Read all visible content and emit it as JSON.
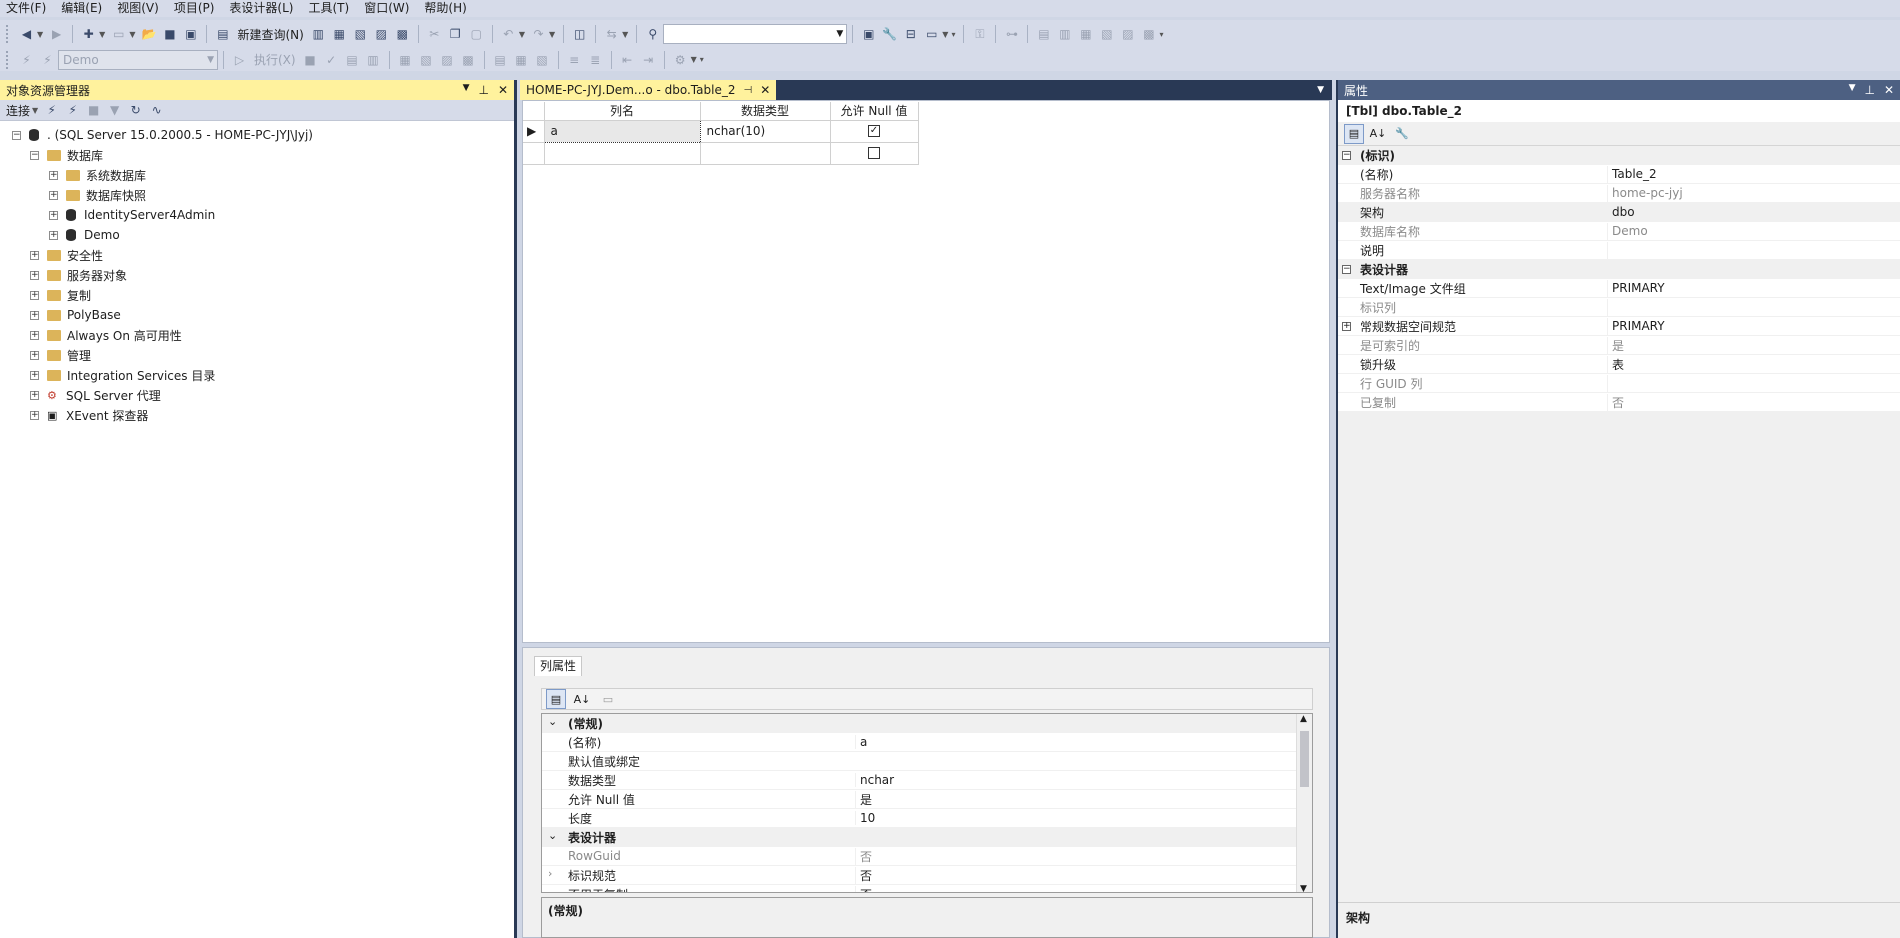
{
  "menu": [
    "文件(F)",
    "编辑(E)",
    "视图(V)",
    "项目(P)",
    "表设计器(L)",
    "工具(T)",
    "窗口(W)",
    "帮助(H)"
  ],
  "toolbar": {
    "new_query": "新建查询(N)",
    "database_combo": "Demo",
    "execute": "执行(X)"
  },
  "explorer": {
    "title": "对象资源管理器",
    "connect": "连接",
    "server": ". (SQL Server 15.0.2000.5 - HOME-PC-JYJ\\Jyj)",
    "databases": "数据库",
    "system_databases": "系统数据库",
    "snapshots": "数据库快照",
    "db1": "IdentityServer4Admin",
    "db2": "Demo",
    "security": "安全性",
    "server_objects": "服务器对象",
    "replication": "复制",
    "polybase": "PolyBase",
    "alwayson": "Always On 高可用性",
    "management": "管理",
    "integration": "Integration Services 目录",
    "agent": "SQL Server 代理",
    "xevent": "XEvent 探查器"
  },
  "document": {
    "tab_title": "HOME-PC-JYJ.Dem...o - dbo.Table_2",
    "columns_header": [
      "列名",
      "数据类型",
      "允许 Null 值"
    ],
    "rows": [
      {
        "name": "a",
        "type": "nchar(10)",
        "allow_null": true
      },
      {
        "name": "",
        "type": "",
        "allow_null": false
      }
    ]
  },
  "column_properties": {
    "tab": "列属性",
    "rows": [
      {
        "key": "(常规)",
        "value": "",
        "cat": true
      },
      {
        "key": "(名称)",
        "value": "a"
      },
      {
        "key": "默认值或绑定",
        "value": ""
      },
      {
        "key": "数据类型",
        "value": "nchar"
      },
      {
        "key": "允许 Null 值",
        "value": "是"
      },
      {
        "key": "长度",
        "value": "10"
      },
      {
        "key": "表设计器",
        "value": "",
        "cat": true
      },
      {
        "key": "RowGuid",
        "value": "否",
        "gray": true
      },
      {
        "key": "标识规范",
        "value": "否"
      },
      {
        "key": "不用于复制",
        "value": "否"
      }
    ],
    "description": "(常规)"
  },
  "properties": {
    "title": "属性",
    "object": "[Tbl] dbo.Table_2",
    "rows": [
      {
        "key": "(标识)",
        "value": "",
        "cat": true
      },
      {
        "key": "(名称)",
        "value": "Table_2"
      },
      {
        "key": "服务器名称",
        "value": "home-pc-jyj",
        "gray": true
      },
      {
        "key": "架构",
        "value": "dbo",
        "sel": true
      },
      {
        "key": "数据库名称",
        "value": "Demo",
        "gray": true
      },
      {
        "key": "说明",
        "value": ""
      },
      {
        "key": "表设计器",
        "value": "",
        "cat": true
      },
      {
        "key": "Text/Image 文件组",
        "value": "PRIMARY"
      },
      {
        "key": "标识列",
        "value": "",
        "gray": true
      },
      {
        "key": "常规数据空间规范",
        "value": "PRIMARY",
        "plus": true
      },
      {
        "key": "是可索引的",
        "value": "是",
        "gray": true
      },
      {
        "key": "锁升级",
        "value": "表"
      },
      {
        "key": "行 GUID 列",
        "value": "",
        "gray": true
      },
      {
        "key": "已复制",
        "value": "否",
        "gray": true
      }
    ],
    "description": "架构"
  },
  "colors": {
    "chrome": "#d6dbe9",
    "title_active": "#fff29d",
    "title_inactive": "#4d6082",
    "dark": "#293955"
  }
}
